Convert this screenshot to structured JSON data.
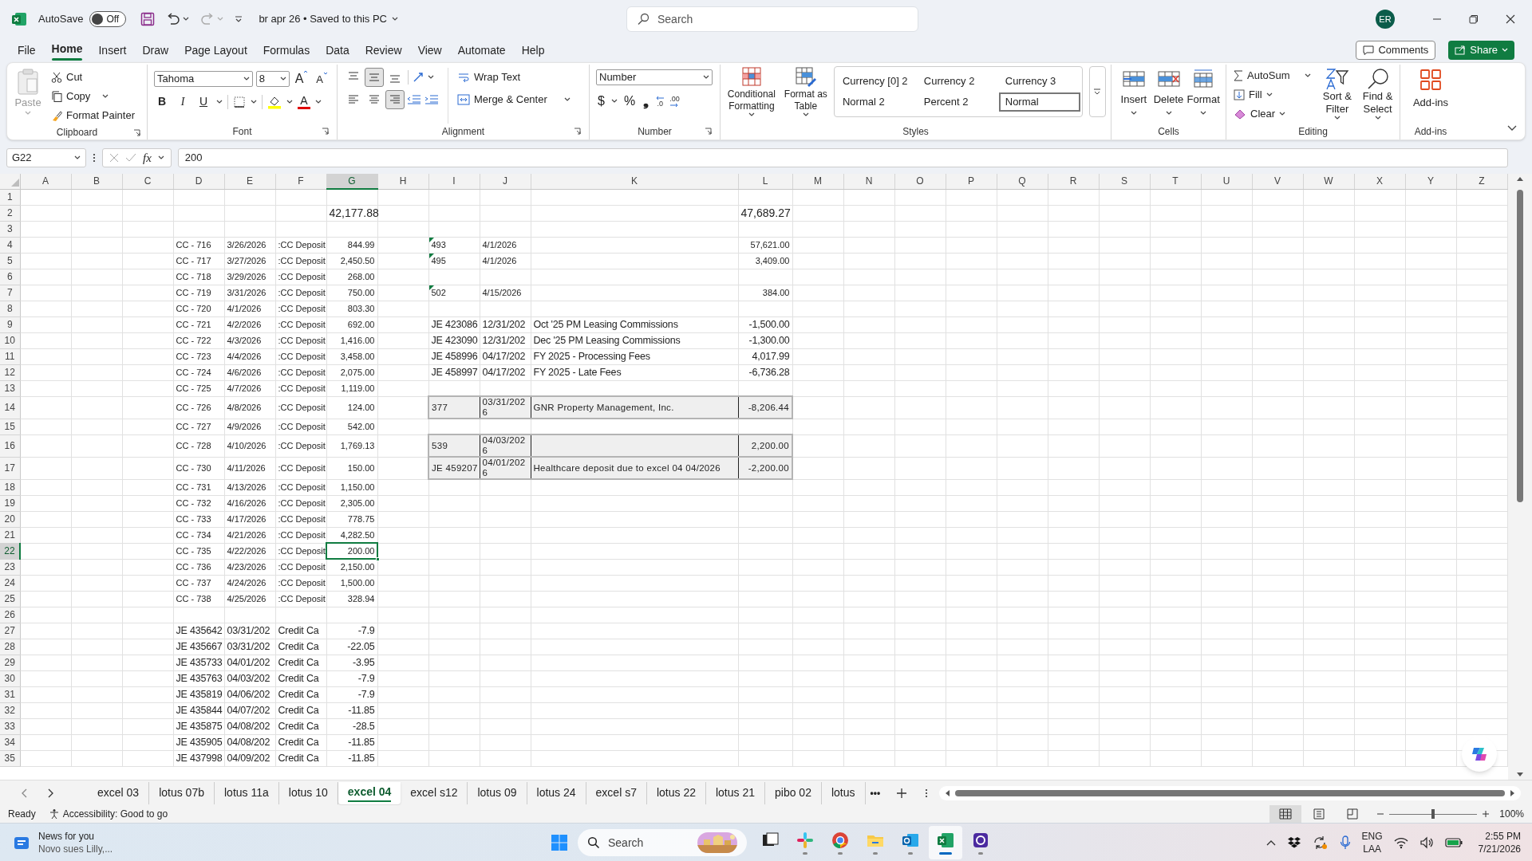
{
  "title_bar": {
    "autosave_label": "AutoSave",
    "autosave": {
      "label": "Off",
      "on": false
    },
    "document_title": "br apr 26 • Saved to this PC",
    "search_placeholder": "Search",
    "account_initials": "ER"
  },
  "menu_tabs": [
    {
      "label": "File",
      "selected": false
    },
    {
      "label": "Home",
      "selected": true
    },
    {
      "label": "Insert",
      "selected": false
    },
    {
      "label": "Draw",
      "selected": false
    },
    {
      "label": "Page Layout",
      "selected": false
    },
    {
      "label": "Formulas",
      "selected": false
    },
    {
      "label": "Data",
      "selected": false
    },
    {
      "label": "Review",
      "selected": false
    },
    {
      "label": "View",
      "selected": false
    },
    {
      "label": "Automate",
      "selected": false
    },
    {
      "label": "Help",
      "selected": false
    }
  ],
  "comments_button": "Comments",
  "share_button": "Share",
  "ribbon": {
    "clipboard": {
      "label": "Clipboard",
      "paste": "Paste",
      "cut": "Cut",
      "copy": "Copy",
      "format_painter": "Format Painter"
    },
    "font": {
      "label": "Font",
      "font_name": "Tahoma",
      "font_size": "8",
      "grow_font": "A",
      "shrink_font": "A",
      "bold": "B",
      "italic": "I",
      "underline": "U",
      "font_color": "A"
    },
    "alignment": {
      "label": "Alignment",
      "vertical_align": [
        {
          "selected": false
        },
        {
          "selected": true
        },
        {
          "selected": false
        }
      ],
      "horizontal_align": [
        {
          "selected": false
        },
        {
          "selected": false
        },
        {
          "selected": true
        }
      ],
      "wrap_text": "Wrap Text",
      "merge_center": "Merge & Center"
    },
    "number": {
      "label": "Number",
      "format": "Number",
      "currency": "$",
      "percent": "%",
      "comma": "❟",
      "decrease_decimal": ".0",
      "increase_decimal": ".00"
    },
    "styles": {
      "label": "Styles",
      "conditional_formatting": "Conditional Formatting",
      "format_as_table": "Format as Table",
      "gallery": [
        {
          "label": "Currency [0] 2",
          "selected": false
        },
        {
          "label": "Currency 2",
          "selected": false
        },
        {
          "label": "Currency 3",
          "selected": false
        },
        {
          "label": "Normal 2",
          "selected": false
        },
        {
          "label": "Percent 2",
          "selected": false
        },
        {
          "label": "Normal",
          "selected": true
        }
      ]
    },
    "cells": {
      "label": "Cells",
      "insert": "Insert",
      "delete": "Delete",
      "format": "Format"
    },
    "editing": {
      "label": "Editing",
      "autosum": "AutoSum",
      "fill": "Fill",
      "clear": "Clear",
      "sort_filter": "Sort & Filter",
      "find_select": "Find & Select"
    },
    "addins": {
      "label": "Add-ins",
      "addins": "Add-ins"
    }
  },
  "formula_bar": {
    "name_box": "G22",
    "fx": "fx",
    "value": "200"
  },
  "sheet": {
    "columns": [
      {
        "label": "A",
        "selected": false
      },
      {
        "label": "B",
        "selected": false
      },
      {
        "label": "C",
        "selected": false
      },
      {
        "label": "D",
        "selected": false
      },
      {
        "label": "E",
        "selected": false
      },
      {
        "label": "F",
        "selected": false
      },
      {
        "label": "G",
        "selected": true
      },
      {
        "label": "H",
        "selected": false
      },
      {
        "label": "I",
        "selected": false
      },
      {
        "label": "J",
        "selected": false
      },
      {
        "label": "K",
        "selected": false
      },
      {
        "label": "L",
        "selected": false
      },
      {
        "label": "M",
        "selected": false
      },
      {
        "label": "N",
        "selected": false
      },
      {
        "label": "O",
        "selected": false
      },
      {
        "label": "P",
        "selected": false
      },
      {
        "label": "Q",
        "selected": false
      },
      {
        "label": "R",
        "selected": false
      },
      {
        "label": "S",
        "selected": false
      },
      {
        "label": "T",
        "selected": false
      },
      {
        "label": "U",
        "selected": false
      },
      {
        "label": "V",
        "selected": false
      },
      {
        "label": "W",
        "selected": false
      },
      {
        "label": "X",
        "selected": false
      },
      {
        "label": "Y",
        "selected": false
      },
      {
        "label": "Z",
        "selected": false
      }
    ],
    "rows": [
      {
        "number": "1",
        "selected": false
      },
      {
        "number": "2",
        "selected": false,
        "d_to_g": {
          "kind": "total",
          "selected": false,
          "amount": "42,177.88"
        },
        "i_to_l": {
          "kind": "total",
          "warning": false,
          "boxed": false,
          "amount": "47,689.27"
        }
      },
      {
        "number": "3",
        "selected": false
      },
      {
        "number": "4",
        "selected": false,
        "d_to_g": {
          "kind": "deposit",
          "selected": false,
          "reference": "CC - 716",
          "date": "3/26/2026",
          "description": ":CC Deposit",
          "amount": "844.99"
        },
        "i_to_l": {
          "kind": "check",
          "warning": true,
          "boxed": false,
          "reference": "493",
          "date": "4/1/2026",
          "amount": "57,621.00"
        }
      },
      {
        "number": "5",
        "selected": false,
        "d_to_g": {
          "kind": "deposit",
          "selected": false,
          "reference": "CC - 717",
          "date": "3/27/2026",
          "description": ":CC Deposit",
          "amount": "2,450.50"
        },
        "i_to_l": {
          "kind": "check",
          "warning": true,
          "boxed": false,
          "reference": "495",
          "date": "4/1/2026",
          "amount": "3,409.00"
        }
      },
      {
        "number": "6",
        "selected": false,
        "d_to_g": {
          "kind": "deposit",
          "selected": false,
          "reference": "CC - 718",
          "date": "3/29/2026",
          "description": ":CC Deposit",
          "amount": "268.00"
        }
      },
      {
        "number": "7",
        "selected": false,
        "d_to_g": {
          "kind": "deposit",
          "selected": false,
          "reference": "CC - 719",
          "date": "3/31/2026",
          "description": ":CC Deposit",
          "amount": "750.00"
        },
        "i_to_l": {
          "kind": "check",
          "warning": true,
          "boxed": false,
          "reference": "502",
          "date": "4/15/2026",
          "amount": "384.00"
        }
      },
      {
        "number": "8",
        "selected": false,
        "d_to_g": {
          "kind": "deposit",
          "selected": false,
          "reference": "CC - 720",
          "date": "4/1/2026",
          "description": ":CC Deposit",
          "amount": "803.30"
        }
      },
      {
        "number": "9",
        "selected": false,
        "d_to_g": {
          "kind": "deposit",
          "selected": false,
          "reference": "CC - 721",
          "date": "4/2/2026",
          "description": ":CC Deposit",
          "amount": "692.00"
        },
        "i_to_l": {
          "kind": "journal",
          "warning": false,
          "boxed": false,
          "reference": "JE 423086",
          "date": "12/31/202",
          "description": "Oct '25 PM Leasing Commissions",
          "amount": "-1,500.00"
        }
      },
      {
        "number": "10",
        "selected": false,
        "d_to_g": {
          "kind": "deposit",
          "selected": false,
          "reference": "CC - 722",
          "date": "4/3/2026",
          "description": ":CC Deposit",
          "amount": "1,416.00"
        },
        "i_to_l": {
          "kind": "journal",
          "warning": false,
          "boxed": false,
          "reference": "JE 423090",
          "date": "12/31/202",
          "description": "Dec '25 PM Leasing Commissions",
          "amount": "-1,300.00"
        }
      },
      {
        "number": "11",
        "selected": false,
        "d_to_g": {
          "kind": "deposit",
          "selected": false,
          "reference": "CC - 723",
          "date": "4/4/2026",
          "description": ":CC Deposit",
          "amount": "3,458.00"
        },
        "i_to_l": {
          "kind": "journal",
          "warning": false,
          "boxed": false,
          "reference": "JE 458996",
          "date": "04/17/202",
          "description": "FY 2025 - Processing Fees",
          "amount": "4,017.99"
        }
      },
      {
        "number": "12",
        "selected": false,
        "d_to_g": {
          "kind": "deposit",
          "selected": false,
          "reference": "CC - 724",
          "date": "4/6/2026",
          "description": ":CC Deposit",
          "amount": "2,075.00"
        },
        "i_to_l": {
          "kind": "journal",
          "warning": false,
          "boxed": false,
          "reference": "JE 458997",
          "date": "04/17/202",
          "description": "FY 2025 - Late Fees",
          "amount": "-6,736.28"
        }
      },
      {
        "number": "13",
        "selected": false,
        "d_to_g": {
          "kind": "deposit",
          "selected": false,
          "reference": "CC - 725",
          "date": "4/7/2026",
          "description": ":CC Deposit",
          "amount": "1,119.00"
        }
      },
      {
        "number": "14",
        "selected": false,
        "d_to_g": {
          "kind": "deposit",
          "selected": false,
          "reference": "CC - 726",
          "date": "4/8/2026",
          "description": ":CC Deposit",
          "amount": "124.00"
        },
        "i_to_l": {
          "kind": "reconciling",
          "warning": false,
          "boxed": true,
          "reference": "377",
          "date": "03/31/2026",
          "description": "GNR Property Management, Inc.",
          "amount": "-8,206.44"
        }
      },
      {
        "number": "15",
        "selected": false,
        "d_to_g": {
          "kind": "deposit",
          "selected": false,
          "reference": "CC - 727",
          "date": "4/9/2026",
          "description": ":CC Deposit",
          "amount": "542.00"
        }
      },
      {
        "number": "16",
        "selected": false,
        "d_to_g": {
          "kind": "deposit",
          "selected": false,
          "reference": "CC - 728",
          "date": "4/10/2026",
          "description": ":CC Deposit",
          "amount": "1,769.13"
        },
        "i_to_l": {
          "kind": "reconciling",
          "warning": false,
          "boxed": true,
          "reference": "539",
          "date": "04/03/2026",
          "amount": "2,200.00"
        }
      },
      {
        "number": "17",
        "selected": false,
        "d_to_g": {
          "kind": "deposit",
          "selected": false,
          "reference": "CC - 730",
          "date": "4/11/2026",
          "description": ":CC Deposit",
          "amount": "150.00"
        },
        "i_to_l": {
          "kind": "reconciling",
          "warning": false,
          "boxed": true,
          "reference": "JE 459207",
          "date": "04/01/2026",
          "description": "Healthcare deposit due to excel 04 04/2026",
          "amount": "-2,200.00"
        }
      },
      {
        "number": "18",
        "selected": false,
        "d_to_g": {
          "kind": "deposit",
          "selected": false,
          "reference": "CC - 731",
          "date": "4/13/2026",
          "description": ":CC Deposit",
          "amount": "1,150.00"
        }
      },
      {
        "number": "19",
        "selected": false,
        "d_to_g": {
          "kind": "deposit",
          "selected": false,
          "reference": "CC - 732",
          "date": "4/16/2026",
          "description": ":CC Deposit",
          "amount": "2,305.00"
        }
      },
      {
        "number": "20",
        "selected": false,
        "d_to_g": {
          "kind": "deposit",
          "selected": false,
          "reference": "CC - 733",
          "date": "4/17/2026",
          "description": ":CC Deposit",
          "amount": "778.75"
        }
      },
      {
        "number": "21",
        "selected": false,
        "d_to_g": {
          "kind": "deposit",
          "selected": false,
          "reference": "CC - 734",
          "date": "4/21/2026",
          "description": ":CC Deposit",
          "amount": "4,282.50"
        }
      },
      {
        "number": "22",
        "selected": true,
        "d_to_g": {
          "kind": "deposit",
          "selected": true,
          "reference": "CC - 735",
          "date": "4/22/2026",
          "description": ":CC Deposit",
          "amount": "200.00"
        }
      },
      {
        "number": "23",
        "selected": false,
        "d_to_g": {
          "kind": "deposit",
          "selected": false,
          "reference": "CC - 736",
          "date": "4/23/2026",
          "description": ":CC Deposit",
          "amount": "2,150.00"
        }
      },
      {
        "number": "24",
        "selected": false,
        "d_to_g": {
          "kind": "deposit",
          "selected": false,
          "reference": "CC - 737",
          "date": "4/24/2026",
          "description": ":CC Deposit",
          "amount": "1,500.00"
        }
      },
      {
        "number": "25",
        "selected": false,
        "d_to_g": {
          "kind": "deposit",
          "selected": false,
          "reference": "CC - 738",
          "date": "4/25/2026",
          "description": ":CC Deposit",
          "amount": "328.94"
        }
      },
      {
        "number": "26",
        "selected": false
      },
      {
        "number": "27",
        "selected": false,
        "d_to_g": {
          "kind": "journal",
          "selected": false,
          "reference": "JE 435642",
          "date": "03/31/202",
          "description": "Credit Ca",
          "amount": "-7.9"
        }
      },
      {
        "number": "28",
        "selected": false,
        "d_to_g": {
          "kind": "journal",
          "selected": false,
          "reference": "JE 435667",
          "date": "03/31/202",
          "description": "Credit Ca",
          "amount": "-22.05"
        }
      },
      {
        "number": "29",
        "selected": false,
        "d_to_g": {
          "kind": "journal",
          "selected": false,
          "reference": "JE 435733",
          "date": "04/01/202",
          "description": "Credit Ca",
          "amount": "-3.95"
        }
      },
      {
        "number": "30",
        "selected": false,
        "d_to_g": {
          "kind": "journal",
          "selected": false,
          "reference": "JE 435763",
          "date": "04/03/202",
          "description": "Credit Ca",
          "amount": "-7.9"
        }
      },
      {
        "number": "31",
        "selected": false,
        "d_to_g": {
          "kind": "journal",
          "selected": false,
          "reference": "JE 435819",
          "date": "04/06/202",
          "description": "Credit Ca",
          "amount": "-7.9"
        }
      },
      {
        "number": "32",
        "selected": false,
        "d_to_g": {
          "kind": "journal",
          "selected": false,
          "reference": "JE 435844",
          "date": "04/07/202",
          "description": "Credit Ca",
          "amount": "-11.85"
        }
      },
      {
        "number": "33",
        "selected": false,
        "d_to_g": {
          "kind": "journal",
          "selected": false,
          "reference": "JE 435875",
          "date": "04/08/202",
          "description": "Credit Ca",
          "amount": "-28.5"
        }
      },
      {
        "number": "34",
        "selected": false,
        "d_to_g": {
          "kind": "journal",
          "selected": false,
          "reference": "JE 435905",
          "date": "04/08/202",
          "description": "Credit Ca",
          "amount": "-11.85"
        }
      },
      {
        "number": "35",
        "selected": false,
        "d_to_g": {
          "kind": "journal",
          "selected": false,
          "reference": "JE 437998",
          "date": "04/09/202",
          "description": "Credit Ca",
          "amount": "-11.85"
        }
      }
    ]
  },
  "sheet_tabs": [
    {
      "label": "excel 03",
      "selected": false
    },
    {
      "label": "lotus 07b",
      "selected": false
    },
    {
      "label": "lotus 11a",
      "selected": false
    },
    {
      "label": "lotus 10",
      "selected": false
    },
    {
      "label": "excel 04",
      "selected": true
    },
    {
      "label": "excel s12",
      "selected": false
    },
    {
      "label": "lotus 09",
      "selected": false
    },
    {
      "label": "lotus 24",
      "selected": false
    },
    {
      "label": "excel s7",
      "selected": false
    },
    {
      "label": "lotus 22",
      "selected": false
    },
    {
      "label": "lotus 21",
      "selected": false
    },
    {
      "label": "pibo 02",
      "selected": false
    },
    {
      "label": "lotus",
      "selected": false
    }
  ],
  "more_sheets": "•••",
  "status_bar": {
    "ready": "Ready",
    "accessibility": "Accessibility: Good to go",
    "views": [
      {
        "selected": true
      },
      {
        "selected": false
      },
      {
        "selected": false
      }
    ],
    "zoom": {
      "level": 0.5,
      "reading": "100%"
    }
  },
  "taskbar": {
    "news": {
      "title": "News for you",
      "subtitle": "Novo sues Lilly,..."
    },
    "search_placeholder": "Search",
    "apps": [
      {
        "kind": "taskview",
        "running": false,
        "active": false
      },
      {
        "kind": "slack",
        "running": true,
        "active": false
      },
      {
        "kind": "chrome",
        "running": true,
        "active": false
      },
      {
        "kind": "files",
        "running": true,
        "active": false
      },
      {
        "kind": "outlook",
        "running": true,
        "active": false
      },
      {
        "kind": "excel",
        "running": true,
        "active": true
      },
      {
        "kind": "gapp",
        "running": true,
        "active": false
      }
    ],
    "language": "ENG",
    "layout": "LAA",
    "time": "2:55 PM",
    "date": "7/21/2026"
  }
}
